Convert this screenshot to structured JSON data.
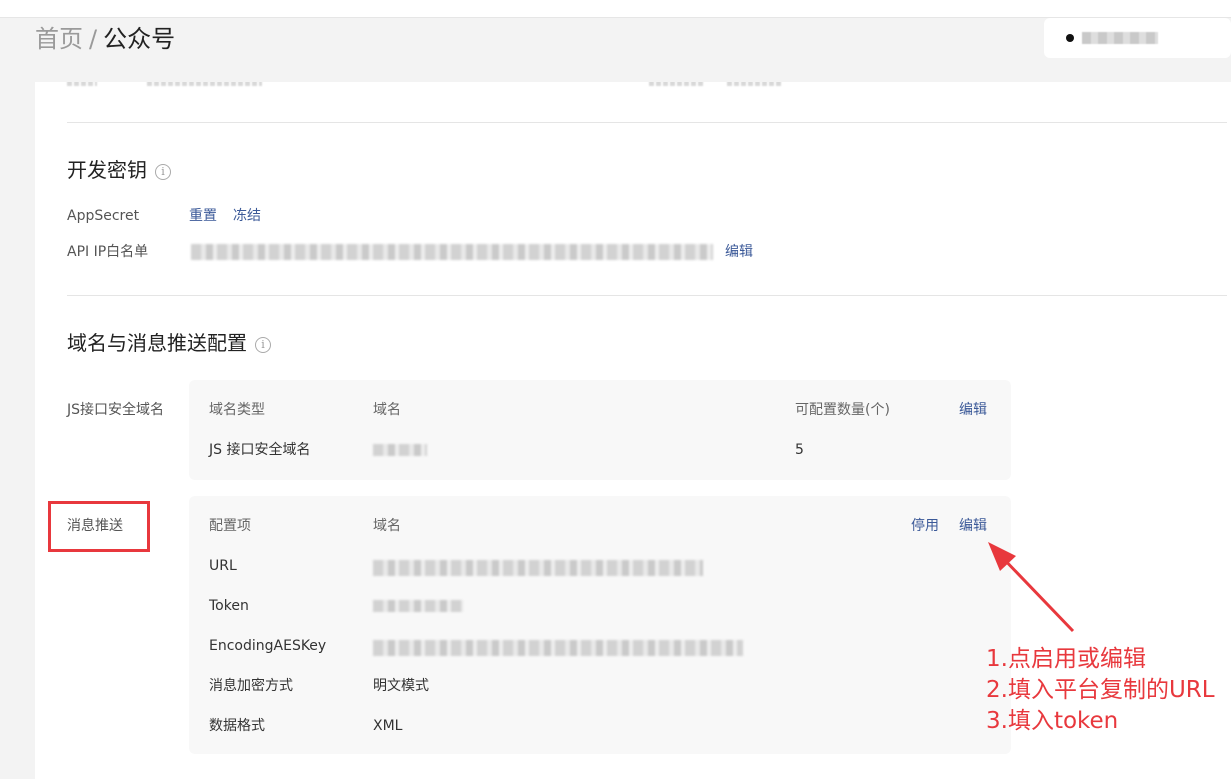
{
  "breadcrumb": {
    "home": "首页",
    "separator": "/",
    "current": "公众号"
  },
  "dev_key": {
    "title": "开发密钥",
    "appsecret_label": "AppSecret",
    "reset_label": "重置",
    "freeze_label": "冻结",
    "ip_whitelist_label": "API IP白名单",
    "edit_label": "编辑"
  },
  "domain_config": {
    "title": "域名与消息推送配置",
    "js_domain": {
      "label": "JS接口安全域名",
      "headers": {
        "type": "域名类型",
        "domain": "域名",
        "count": "可配置数量(个)",
        "edit": "编辑"
      },
      "row": {
        "type": "JS 接口安全域名",
        "count": "5"
      }
    },
    "message_push": {
      "label": "消息推送",
      "headers": {
        "item": "配置项",
        "domain": "域名",
        "disable": "停用",
        "edit": "编辑"
      },
      "rows": [
        {
          "key": "URL"
        },
        {
          "key": "Token"
        },
        {
          "key": "EncodingAESKey"
        },
        {
          "key": "消息加密方式",
          "value": "明文模式"
        },
        {
          "key": "数据格式",
          "value": "XML"
        }
      ]
    }
  },
  "annotation": {
    "text": "1.点启用或编辑\n2.填入平台复制的URL\n3.填入token",
    "color": "#e8383d"
  }
}
